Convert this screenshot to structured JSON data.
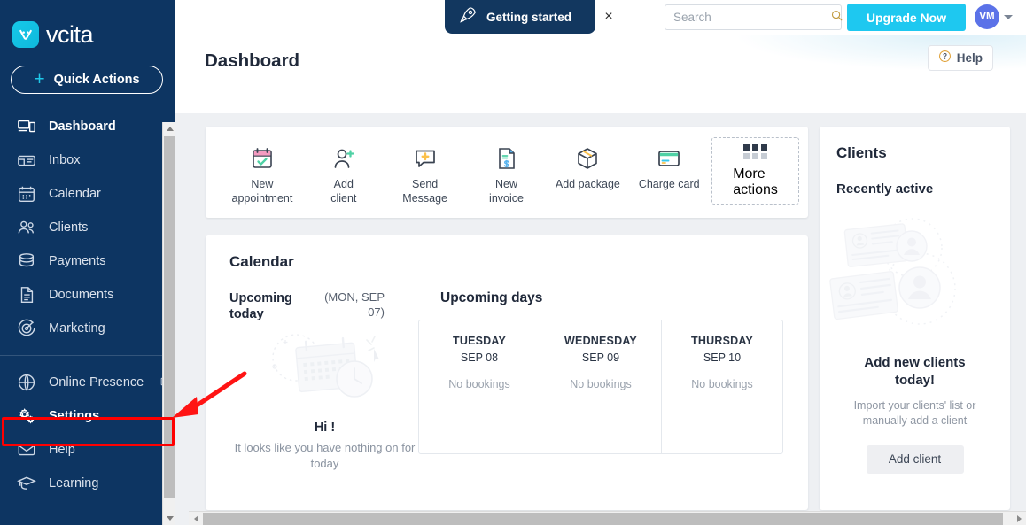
{
  "brand": {
    "name": "vcita",
    "accent": "#1ec8e8",
    "sidebar_bg": "#0d3562"
  },
  "topbar": {
    "getting_started": "Getting started",
    "getting_started_icon": "rocket-icon",
    "close_label": "×",
    "search_placeholder": "Search",
    "search_value": "",
    "search_icon": "search-icon",
    "upgrade_label": "Upgrade Now",
    "avatar_initials": "VM",
    "avatar_color": "#5b72e8",
    "caret_icon": "chevron-down-icon"
  },
  "page": {
    "title": "Dashboard",
    "help_label": "Help",
    "help_icon": "question-circle-icon"
  },
  "sidebar": {
    "quick_actions_label": "Quick Actions",
    "quick_actions_icon": "plus-icon",
    "items": [
      {
        "label": "Dashboard",
        "icon": "dashboard-icon",
        "active": true
      },
      {
        "label": "Inbox",
        "icon": "inbox-icon",
        "active": false
      },
      {
        "label": "Calendar",
        "icon": "calendar-icon",
        "active": false
      },
      {
        "label": "Clients",
        "icon": "clients-icon",
        "active": false
      },
      {
        "label": "Payments",
        "icon": "payments-icon",
        "active": false
      },
      {
        "label": "Documents",
        "icon": "documents-icon",
        "active": false
      },
      {
        "label": "Marketing",
        "icon": "marketing-icon",
        "active": false
      }
    ],
    "items_secondary": [
      {
        "label": "Online Presence",
        "icon": "globe-icon",
        "external": true
      },
      {
        "label": "Settings",
        "icon": "gear-icon",
        "external": false,
        "highlighted": true
      },
      {
        "label": "Help",
        "icon": "envelope-icon",
        "external": false
      },
      {
        "label": "Learning",
        "icon": "graduation-cap-icon",
        "external": false
      }
    ],
    "highlight_color": "#ff0000"
  },
  "quick_action_cards": [
    {
      "label_line1": "New",
      "label_line2": "appointment",
      "icon": "calendar-check-icon"
    },
    {
      "label_line1": "Add",
      "label_line2": "client",
      "icon": "user-plus-icon"
    },
    {
      "label_line1": "Send",
      "label_line2": "Message",
      "icon": "message-plus-icon"
    },
    {
      "label_line1": "New",
      "label_line2": "invoice",
      "icon": "invoice-dollar-icon"
    },
    {
      "label_line1": "Add package",
      "label_line2": "",
      "icon": "package-box-icon"
    },
    {
      "label_line1": "Charge card",
      "label_line2": "",
      "icon": "credit-card-icon"
    }
  ],
  "more_actions": {
    "label_line1": "More",
    "label_line2": "actions",
    "icon": "grid-dots-icon"
  },
  "calendar": {
    "title": "Calendar",
    "upcoming_today_label": "Upcoming today",
    "today_date": "(MON, SEP 07)",
    "upcoming_days_label": "Upcoming days",
    "empty_title": "Hi !",
    "empty_text": "It looks like you have nothing on for today",
    "days": [
      {
        "name": "TUESDAY",
        "date": "SEP 08",
        "bookings": "No bookings"
      },
      {
        "name": "WEDNESDAY",
        "date": "SEP 09",
        "bookings": "No bookings"
      },
      {
        "name": "THURSDAY",
        "date": "SEP 10",
        "bookings": "No bookings"
      }
    ]
  },
  "clients": {
    "title": "Clients",
    "subtitle": "Recently active",
    "empty_title": "Add new clients today!",
    "empty_text": "Import your clients' list or manually add a client",
    "add_button": "Add client"
  }
}
